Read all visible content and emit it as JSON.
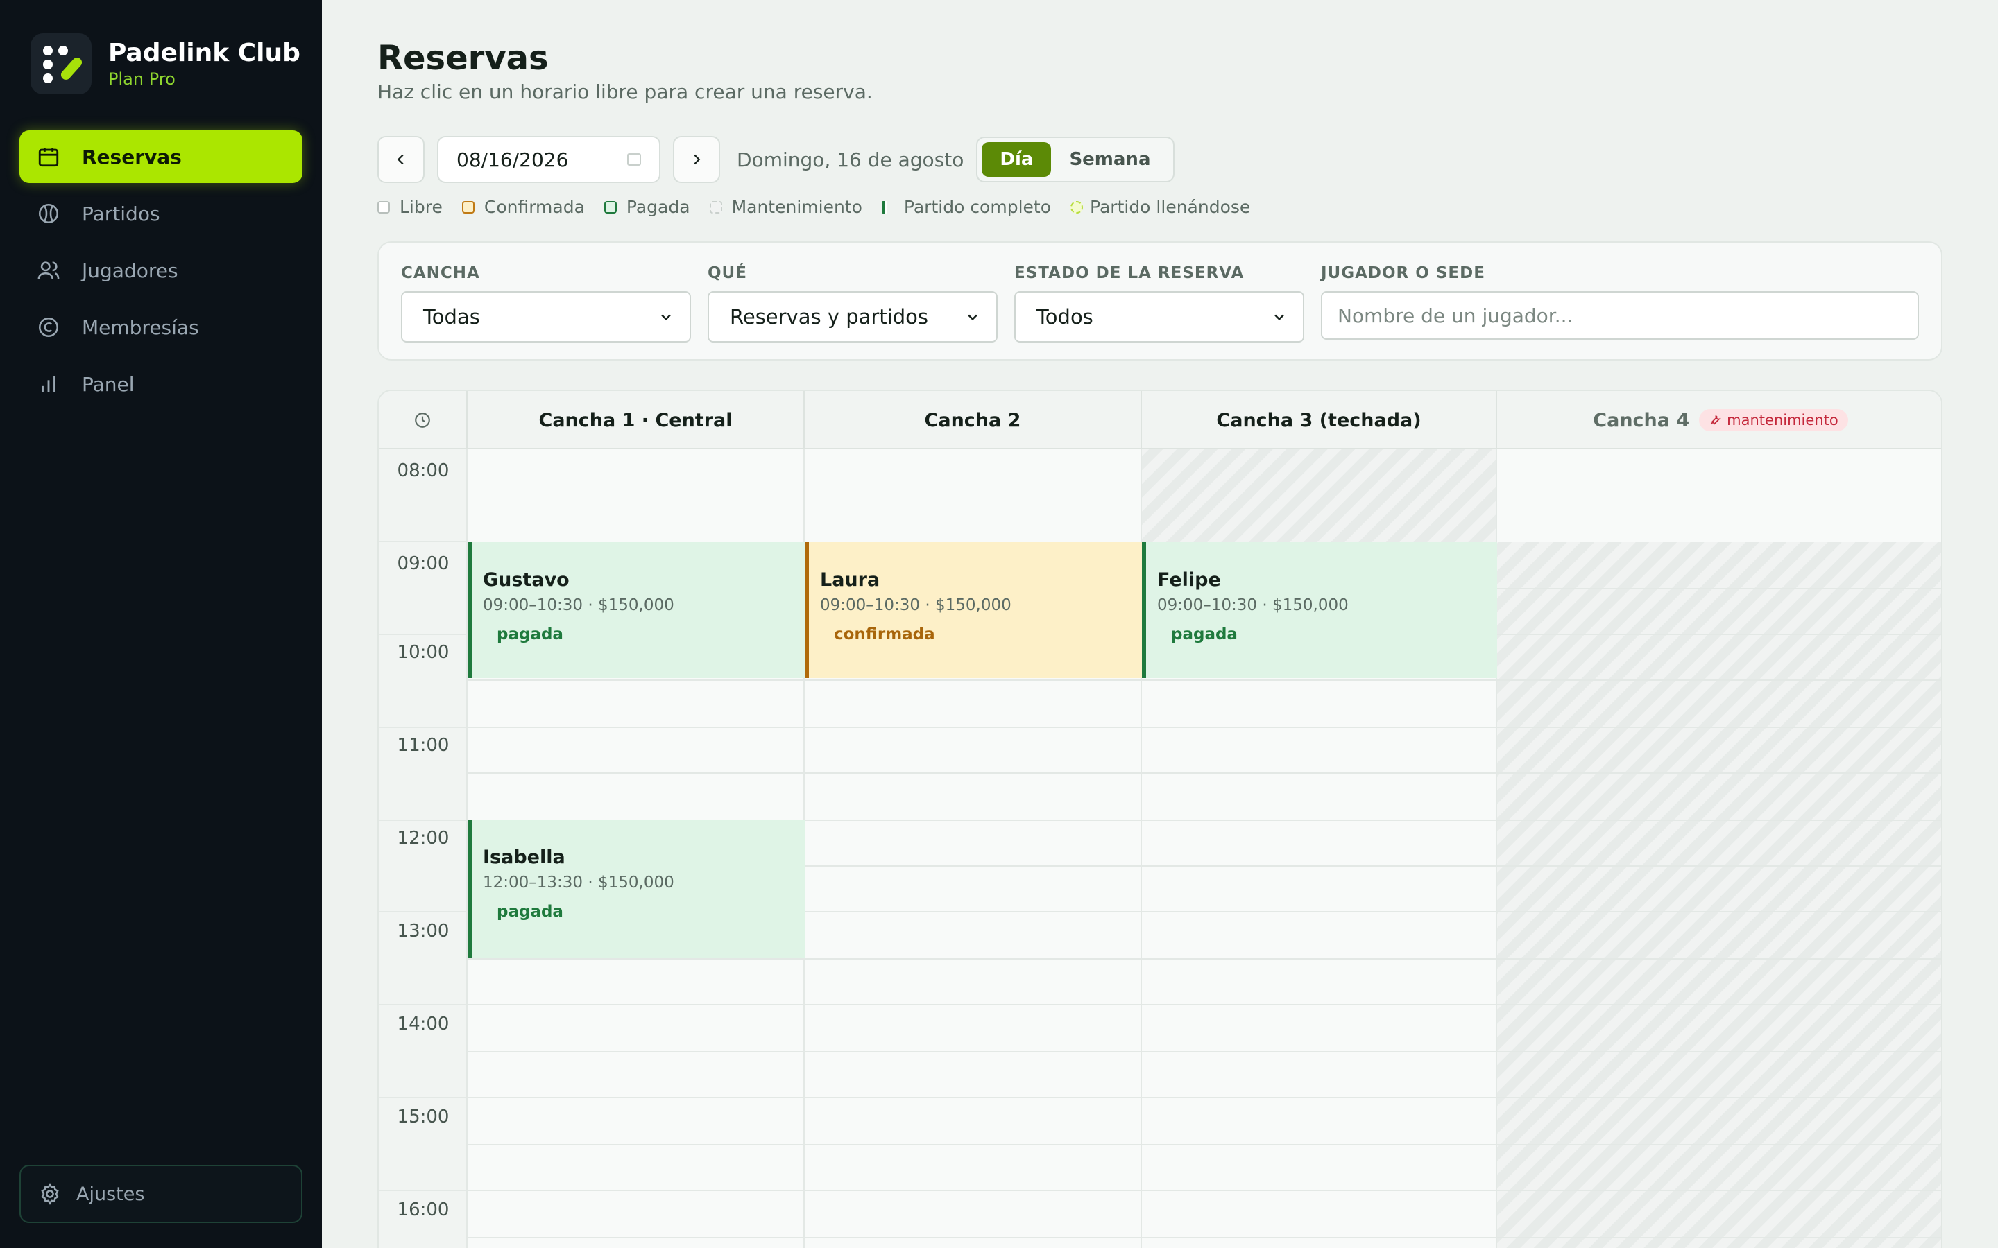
{
  "app": {
    "name": "Padelink Club",
    "plan": "Plan Pro"
  },
  "nav": {
    "items": [
      {
        "label": "Reservas",
        "icon": "calendar-icon",
        "active": true
      },
      {
        "label": "Partidos",
        "icon": "ball-icon",
        "active": false
      },
      {
        "label": "Jugadores",
        "icon": "users-icon",
        "active": false
      },
      {
        "label": "Membresías",
        "icon": "coin-icon",
        "active": false
      },
      {
        "label": "Panel",
        "icon": "bar-chart-icon",
        "active": false
      }
    ],
    "settings_label": "Ajustes"
  },
  "page": {
    "title": "Reservas",
    "subtitle": "Haz clic en un horario libre para crear una reserva."
  },
  "toolbar": {
    "date_value": "08/16/2026",
    "date_label": "Domingo, 16 de agosto",
    "view_day": "Día",
    "view_week": "Semana",
    "active_view": "Día"
  },
  "legend": [
    {
      "label": "Libre",
      "color": "#ffffff",
      "border": "#b8c0bc"
    },
    {
      "label": "Confirmada",
      "color": "#fdf0c8",
      "border": "#c07a14"
    },
    {
      "label": "Pagada",
      "color": "#dff4e6",
      "border": "#1f7a3d"
    },
    {
      "label": "Mantenimiento",
      "color": "#f1f3f2",
      "border": "#c9d0cc"
    },
    {
      "label": "Partido completo",
      "color": "#1f7a3d",
      "border": "#1f7a3d"
    },
    {
      "label": "Partido llenándose",
      "color": "#f4fbd0",
      "border": "#b6dd3a"
    }
  ],
  "filters": {
    "court_label": "CANCHA",
    "court_value": "Todas",
    "what_label": "QUÉ",
    "what_value": "Reservas y partidos",
    "status_label": "ESTADO DE LA RESERVA",
    "status_value": "Todos",
    "search_label": "JUGADOR O SEDE",
    "search_placeholder": "Nombre de un jugador..."
  },
  "schedule": {
    "courts": [
      {
        "name": "Cancha 1 · Central"
      },
      {
        "name": "Cancha 2"
      },
      {
        "name": "Cancha 3 (techada)"
      },
      {
        "name": "Cancha 4",
        "badge": "mantenimiento"
      }
    ],
    "times": [
      "08:00",
      "09:00",
      "10:00",
      "11:00",
      "12:00",
      "13:00",
      "14:00",
      "15:00",
      "16:00"
    ],
    "bookings": [
      {
        "player": "Gustavo",
        "meta": "09:00–10:30 · $150,000",
        "status": "pagada"
      },
      {
        "player": "Laura",
        "meta": "09:00–10:30 · $150,000",
        "status": "confirmada"
      },
      {
        "player": "Felipe",
        "meta": "09:00–10:30 · $150,000",
        "status": "pagada"
      },
      {
        "player": "Isabella",
        "meta": "12:00–13:30 · $150,000",
        "status": "pagada"
      }
    ]
  },
  "colors": {
    "accent": "#abe600",
    "toggle_active": "#5c8a06",
    "paid": "#1f7a3d",
    "confirmed": "#b06a0a",
    "maintenance_badge": "#c4283b"
  }
}
